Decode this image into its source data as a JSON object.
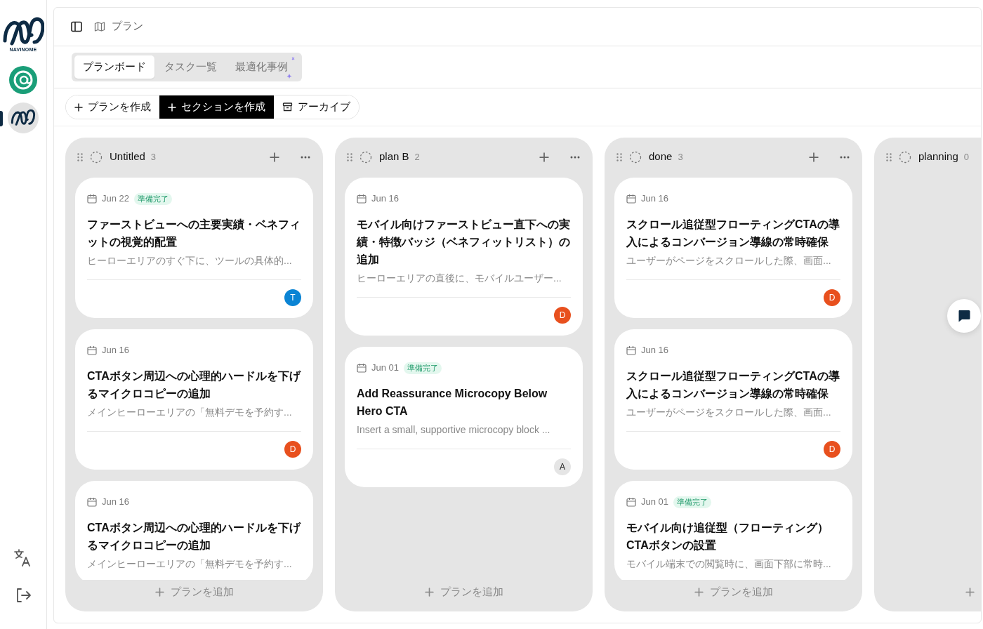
{
  "sidebar": {
    "logo_text": "NAVINOME",
    "apps": [
      {
        "kind": "mail",
        "selected": false
      },
      {
        "kind": "navinome",
        "selected": true
      }
    ]
  },
  "breadcrumb": "プラン",
  "tabs": [
    {
      "label": "プランボード",
      "selected": true
    },
    {
      "label": "タスク一覧",
      "selected": false
    },
    {
      "label": "最適化事例",
      "selected": false
    }
  ],
  "toolbar": [
    {
      "label": "プランを作成",
      "kind": "add"
    },
    {
      "label": "セクションを作成",
      "kind": "primary"
    },
    {
      "label": "アーカイブ",
      "kind": "archive"
    }
  ],
  "columns": [
    {
      "name": "Untitled",
      "count": "3",
      "footer": "プランを追加",
      "cards": [
        {
          "date": "Jun 22",
          "badge": "準備完了",
          "title": "ファーストビューへの主要実績・ベネフィットの視覚的配置",
          "description": "ヒーローエリアのすぐ下に、ツールの具体的...",
          "assignee": "T",
          "color": "#0b84d4"
        },
        {
          "date": "Jun 16",
          "title": "CTAボタン周辺への心理的ハードルを下げるマイクロコピーの追加",
          "description": "メインヒーローエリアの「無料デモを予約す...",
          "assignee": "D",
          "color": "#e8501e"
        },
        {
          "date": "Jun 16",
          "title": "CTAボタン周辺への心理的ハードルを下げるマイクロコピーの追加",
          "description": "メインヒーローエリアの「無料デモを予約す..."
        }
      ]
    },
    {
      "name": "plan B",
      "count": "2",
      "footer": "プランを追加",
      "cards": [
        {
          "date": "Jun 16",
          "title": "モバイル向けファーストビュー直下への実績・特徴バッジ（ベネフィットリスト）の追加",
          "description": "ヒーローエリアの直後に、モバイルユーザー...",
          "assignee": "D",
          "color": "#e8501e"
        },
        {
          "date": "Jun 01",
          "badge": "準備完了",
          "title": "Add Reassurance Microcopy Below Hero CTA",
          "description": "Insert a small, supportive microcopy block ...",
          "assignee": "A",
          "color": "#e5e5e5"
        }
      ]
    },
    {
      "name": "done",
      "count": "3",
      "footer": "プランを追加",
      "cards": [
        {
          "date": "Jun 16",
          "title": "スクロール追従型フローティングCTAの導入によるコンバージョン導線の常時確保",
          "description": "ユーザーがページをスクロールした際、画面...",
          "assignee": "D",
          "color": "#e8501e"
        },
        {
          "date": "Jun 16",
          "title": "スクロール追従型フローティングCTAの導入によるコンバージョン導線の常時確保",
          "description": "ユーザーがページをスクロールした際、画面...",
          "assignee": "D",
          "color": "#e8501e"
        },
        {
          "date": "Jun 01",
          "badge": "準備完了",
          "title": "モバイル向け追従型（フローティング）CTAボタンの設置",
          "description": "モバイル端末での閲覧時に、画面下部に常時..."
        }
      ]
    },
    {
      "name": "planning",
      "count": "0"
    }
  ]
}
